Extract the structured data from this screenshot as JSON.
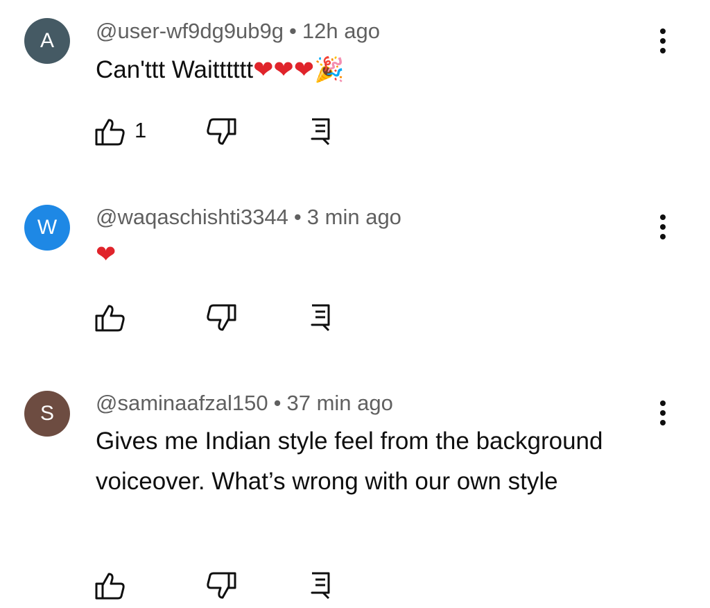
{
  "comments": [
    {
      "avatar_letter": "A",
      "avatar_color": "#455a64",
      "handle": "@user-wf9dg9ub9g",
      "separator": "•",
      "time": "12h ago",
      "text": "Can'ttt Waitttttt",
      "emojis": "❤❤❤🎉",
      "like_count": "1"
    },
    {
      "avatar_letter": "W",
      "avatar_color": "#1e88e5",
      "handle": "@waqaschishti3344",
      "separator": "•",
      "time": "3 min ago",
      "text": "",
      "emojis": "❤",
      "like_count": ""
    },
    {
      "avatar_letter": "S",
      "avatar_color": "#6d4c41",
      "handle": "@saminaafzal150",
      "separator": "•",
      "time": "37 min ago",
      "text": "Gives me Indian style feel from the background voiceover. What’s wrong with our own style",
      "emojis": "",
      "like_count": ""
    }
  ],
  "icons": {
    "like": "thumbs-up-icon",
    "dislike": "thumbs-down-icon",
    "reply": "reply-icon",
    "more": "more-vert-icon"
  }
}
